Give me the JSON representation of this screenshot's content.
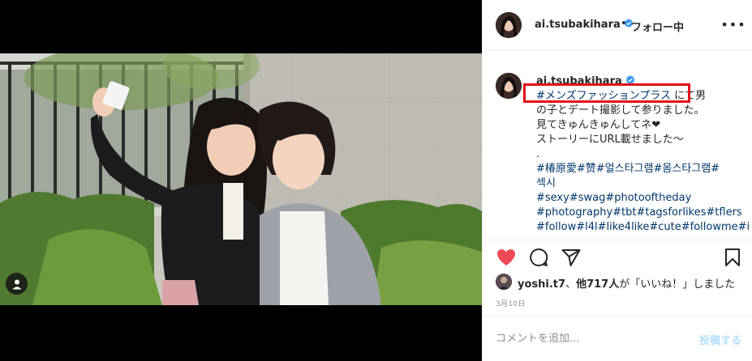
{
  "post": {
    "username": "ai.tsubakihara",
    "separator": "•",
    "follow_status": "フォロー中",
    "more_label": "•••"
  },
  "caption": {
    "username": "ai.tsubakihara",
    "highlighted_hashtag": "#メンズファッションプラス",
    "line1_rest": " にて男",
    "line2": "の子とデート撮影して参りました。",
    "line3": "見てきゅんきゅんしてネ❤",
    "line4": "ストーリーにURL載せました〜",
    "line5": ".",
    "hashtags_line1": "#椿原愛#赞#얼스타그램#몸스타그램#",
    "hashtags_line2": "섹시",
    "hashtags_line3": "#sexy#swag#photooftheday",
    "hashtags_line4": "#photography#tbt#tagsforlikes#tflers",
    "hashtags_line5": "#follow#l4l#like4like#cute#followme#i"
  },
  "likes": {
    "liker": "yoshi.t7",
    "connector": "、",
    "others": "他717人",
    "suffix": "が「いいね！」しました"
  },
  "date": "3月10日",
  "comment": {
    "placeholder": "コメントを追加...",
    "post_label": "投稿する"
  },
  "icons": {
    "like": "heart-filled-icon",
    "comment": "comment-icon",
    "share": "paper-plane-icon",
    "save": "bookmark-icon",
    "tag": "person-tag-icon",
    "verified": "verified-badge-icon"
  },
  "colors": {
    "like_red": "#ed4956",
    "verified_blue": "#3897f0",
    "hashtag_blue": "#00376b",
    "highlight_red": "#e3101b",
    "post_button_disabled": "#b2dffc"
  }
}
